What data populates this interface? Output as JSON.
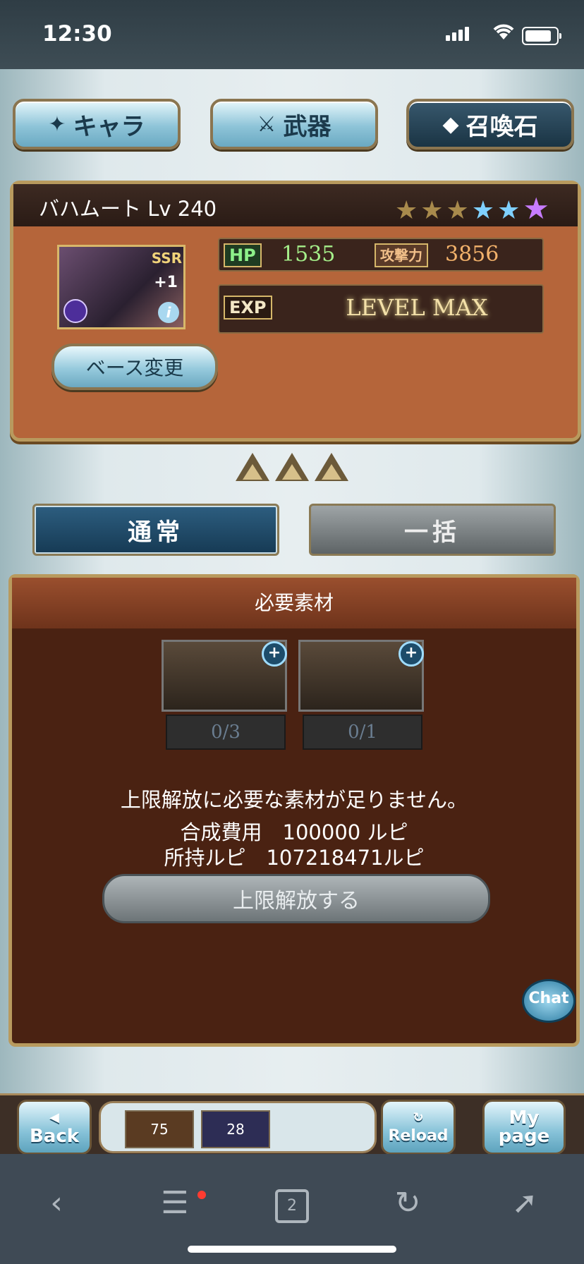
{
  "status_bar": {
    "time": "12:30"
  },
  "tabs": {
    "chara": "キャラ",
    "weapon": "武器",
    "summon": "召喚石"
  },
  "summon": {
    "name": "バハムート Lv 240",
    "rarity": "SSR",
    "plus": "+1",
    "hp_label": "HP",
    "hp": "1535",
    "atk_label": "攻撃力",
    "atk": "3856",
    "exp_label": "EXP",
    "exp_value": "LEVEL MAX",
    "base_change": "ベース変更",
    "stars_total": 6,
    "stars_gold": 3,
    "stars_blue": 2,
    "stars_purple": 1
  },
  "mode": {
    "normal": "通常",
    "bulk": "一括"
  },
  "materials": {
    "title": "必要素材",
    "items": [
      {
        "icon": "hourglass-icon",
        "count": "0/3"
      },
      {
        "icon": "crystal-icon",
        "count": "0/1"
      }
    ],
    "warning": "上限解放に必要な素材が足りません。",
    "cost_line": "合成費用　100000 ルピ",
    "owned_line": "所持ルピ　107218471ルピ",
    "unlock_button": "上限解放する"
  },
  "chat": "Chat",
  "game_bar": {
    "back": "Back",
    "reload": "Reload",
    "mypage_1": "My",
    "mypage_2": "page",
    "item1": "75",
    "item2": "28"
  },
  "browser": {
    "tabs_count": "2"
  }
}
